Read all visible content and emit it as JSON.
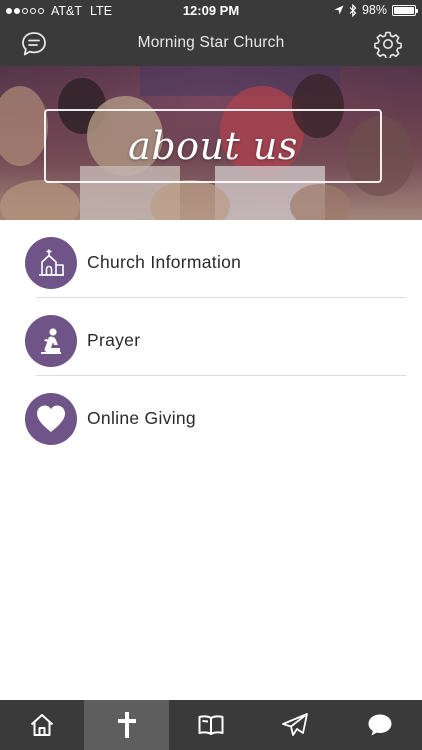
{
  "status_bar": {
    "carrier": "AT&T",
    "network": "LTE",
    "time": "12:09 PM",
    "battery": "98%",
    "battery_level": 0.98,
    "signal_bars_filled": 2,
    "signal_bars_total": 5
  },
  "header": {
    "title": "Morning Star Church",
    "left_icon": "chat-bubble-icon",
    "right_icon": "gear-icon"
  },
  "banner": {
    "text": "about us"
  },
  "menu": {
    "accent_color": "#6f5487",
    "items": [
      {
        "label": "Church Information",
        "icon": "church-icon"
      },
      {
        "label": "Prayer",
        "icon": "kneeling-prayer-icon"
      },
      {
        "label": "Online Giving",
        "icon": "heart-icon"
      }
    ]
  },
  "tab_bar": {
    "active_index": 1,
    "tabs": [
      {
        "icon": "home-icon"
      },
      {
        "icon": "cross-icon"
      },
      {
        "icon": "book-icon"
      },
      {
        "icon": "paper-plane-icon"
      },
      {
        "icon": "speech-bubble-icon"
      }
    ]
  }
}
